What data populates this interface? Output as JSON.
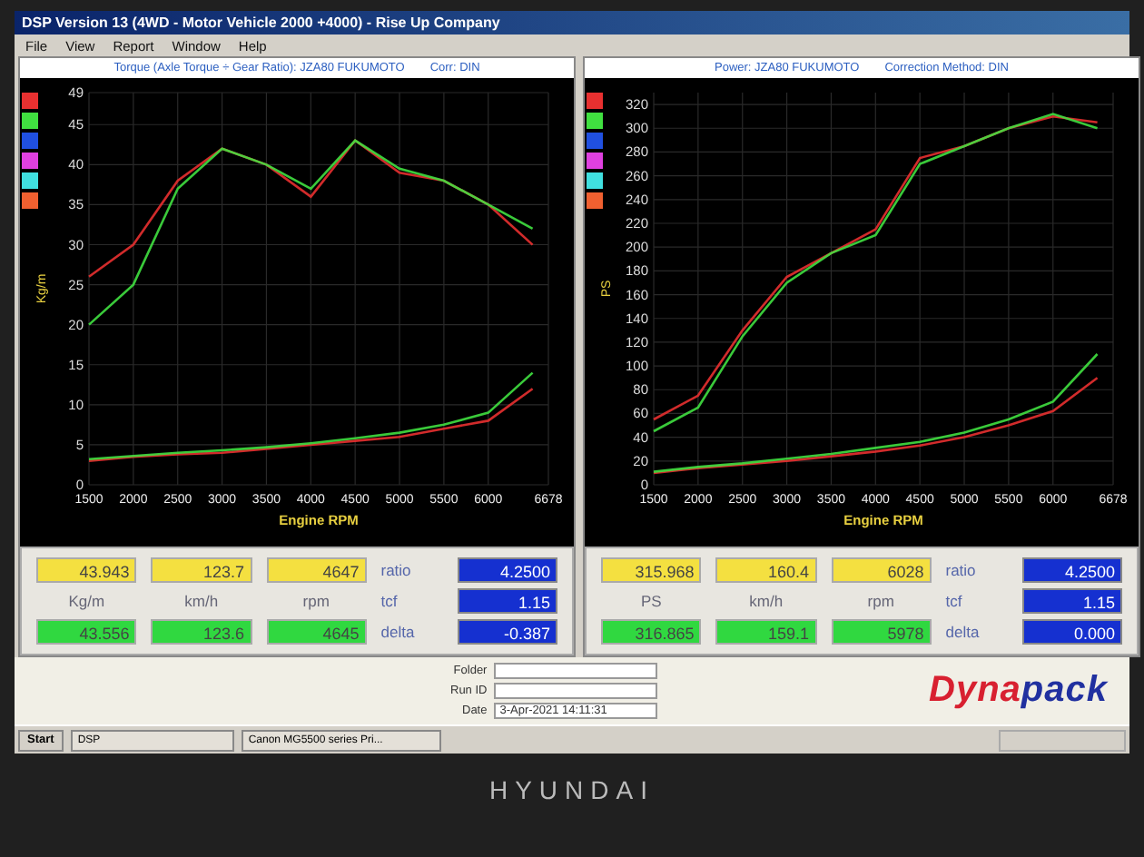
{
  "window": {
    "title": "DSP Version 13 (4WD - Motor Vehicle 2000 +4000) - Rise Up Company"
  },
  "menu": [
    "File",
    "View",
    "Report",
    "Window",
    "Help"
  ],
  "panels": [
    {
      "header": [
        "Torque (Axle Torque ÷ Gear Ratio): JZA80 FUKUMOTO",
        "Corr: DIN"
      ],
      "swatches": [
        {
          "color": "#e83030"
        },
        {
          "color": "#40e040"
        },
        {
          "color": "#2050e0"
        },
        {
          "color": "#e040e0"
        },
        {
          "color": "#40e0e0"
        },
        {
          "color": "#f06030"
        }
      ],
      "chart_data": {
        "type": "line",
        "grid": true,
        "xlabel": "Engine RPM",
        "ylabel": "Kg/m",
        "x": [
          1500,
          2000,
          2500,
          3000,
          3500,
          4000,
          4500,
          5000,
          5500,
          6000,
          6500
        ],
        "xlim": [
          1500,
          6678
        ],
        "ylim": [
          0,
          49
        ],
        "xticks": [
          1500,
          2000,
          2500,
          3000,
          3500,
          4000,
          4500,
          5000,
          5500,
          6000,
          6678
        ],
        "yticks": [
          0,
          5,
          10,
          15,
          20,
          25,
          30,
          35,
          40,
          45,
          49
        ],
        "series": [
          {
            "color": "#e83030",
            "values": [
              26,
              30,
              38,
              42,
              40,
              36,
              43,
              39,
              38,
              35,
              30
            ]
          },
          {
            "color": "#40e040",
            "values": [
              20,
              25,
              37,
              42,
              40,
              37,
              43,
              39.5,
              38,
              35,
              32
            ]
          },
          {
            "color": "#e83030",
            "values": [
              3,
              3.5,
              3.8,
              4,
              4.5,
              5,
              5.5,
              6,
              7,
              8,
              12
            ]
          },
          {
            "color": "#40e040",
            "values": [
              3.2,
              3.6,
              4,
              4.3,
              4.7,
              5.2,
              5.8,
              6.5,
              7.5,
              9,
              14
            ]
          }
        ]
      },
      "readings": {
        "upper": [
          "43.943",
          "123.7",
          "4647"
        ],
        "units": [
          "Kg/m",
          "km/h",
          "rpm"
        ],
        "lower": [
          "43.556",
          "123.6",
          "4645"
        ],
        "params": [
          {
            "label": "ratio",
            "value": "4.2500"
          },
          {
            "label": "tcf",
            "value": "1.15"
          },
          {
            "label": "delta",
            "value": "-0.387"
          }
        ]
      }
    },
    {
      "header": [
        "Power: JZA80 FUKUMOTO",
        "Correction Method: DIN"
      ],
      "swatches": [
        {
          "color": "#e83030"
        },
        {
          "color": "#40e040"
        },
        {
          "color": "#2050e0"
        },
        {
          "color": "#e040e0"
        },
        {
          "color": "#40e0e0"
        },
        {
          "color": "#f06030"
        }
      ],
      "chart_data": {
        "type": "line",
        "grid": true,
        "xlabel": "Engine RPM",
        "ylabel": "PS",
        "x": [
          1500,
          2000,
          2500,
          3000,
          3500,
          4000,
          4500,
          5000,
          5500,
          6000,
          6500
        ],
        "xlim": [
          1500,
          6678
        ],
        "ylim": [
          0,
          330
        ],
        "xticks": [
          1500,
          2000,
          2500,
          3000,
          3500,
          4000,
          4500,
          5000,
          5500,
          6000,
          6678
        ],
        "yticks": [
          0,
          20,
          40,
          60,
          80,
          100,
          120,
          140,
          160,
          180,
          200,
          220,
          240,
          260,
          280,
          300,
          320
        ],
        "series": [
          {
            "color": "#e83030",
            "values": [
              55,
              75,
              130,
              175,
              195,
              215,
              275,
              285,
              300,
              310,
              305
            ]
          },
          {
            "color": "#40e040",
            "values": [
              45,
              65,
              125,
              170,
              195,
              210,
              270,
              285,
              300,
              312,
              300
            ]
          },
          {
            "color": "#e83030",
            "values": [
              10,
              14,
              17,
              20,
              24,
              28,
              33,
              40,
              50,
              62,
              90
            ]
          },
          {
            "color": "#40e040",
            "values": [
              11,
              15,
              18,
              22,
              26,
              31,
              36,
              44,
              55,
              70,
              110
            ]
          }
        ]
      },
      "readings": {
        "upper": [
          "315.968",
          "160.4",
          "6028"
        ],
        "units": [
          "PS",
          "km/h",
          "rpm"
        ],
        "lower": [
          "316.865",
          "159.1",
          "5978"
        ],
        "params": [
          {
            "label": "ratio",
            "value": "4.2500"
          },
          {
            "label": "tcf",
            "value": "1.15"
          },
          {
            "label": "delta",
            "value": "0.000"
          }
        ]
      }
    }
  ],
  "info": {
    "fields": [
      {
        "label": "Folder"
      },
      {
        "label": "Run ID"
      },
      {
        "label": "Date",
        "value": "3-Apr-2021 14:11:31"
      }
    ],
    "logo": [
      "Dyna",
      "pack"
    ]
  },
  "taskbar": {
    "start": "Start",
    "tasks": [
      "DSP",
      "Canon MG5500 series Pri..."
    ]
  },
  "monitor": {
    "brand": "HYUNDAI"
  }
}
